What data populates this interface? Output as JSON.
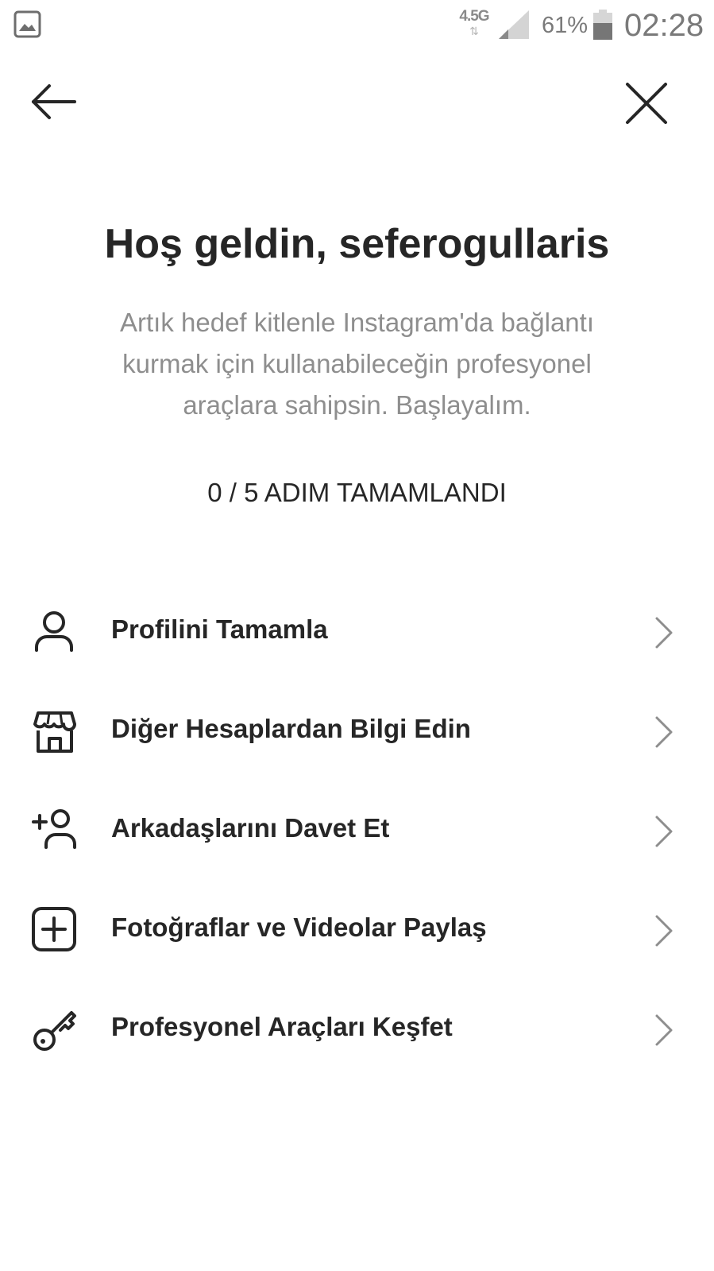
{
  "status_bar": {
    "gallery_icon": "image-icon",
    "network": "4.5G",
    "network_arrows": "⇅",
    "battery_percent": "61%",
    "battery_level": 0.61,
    "time": "02:28"
  },
  "nav": {
    "back_icon": "arrow-left-icon",
    "close_icon": "close-icon"
  },
  "title": "Hoş geldin, seferogullaris",
  "subtitle": "Artık hedef kitlenle Instagram'da bağlantı kurmak için kullanabileceğin profesyonel araçlara sahipsin. Başlayalım.",
  "progress": {
    "label": "0 / 5 ADIM TAMAMLANDI",
    "completed": 0,
    "total": 5
  },
  "steps": [
    {
      "label": "Profilini Tamamla",
      "icon": "person-icon"
    },
    {
      "label": "Diğer Hesaplardan Bilgi Edin",
      "icon": "storefront-icon"
    },
    {
      "label": "Arkadaşlarını Davet Et",
      "icon": "add-person-icon"
    },
    {
      "label": "Fotoğraflar ve Videolar Paylaş",
      "icon": "add-square-icon"
    },
    {
      "label": "Profesyonel Araçları Keşfet",
      "icon": "key-icon"
    }
  ],
  "colors": {
    "text_primary": "#262626",
    "text_secondary": "#8e8e8e",
    "chevron": "#8e8e8e",
    "background": "#ffffff"
  }
}
